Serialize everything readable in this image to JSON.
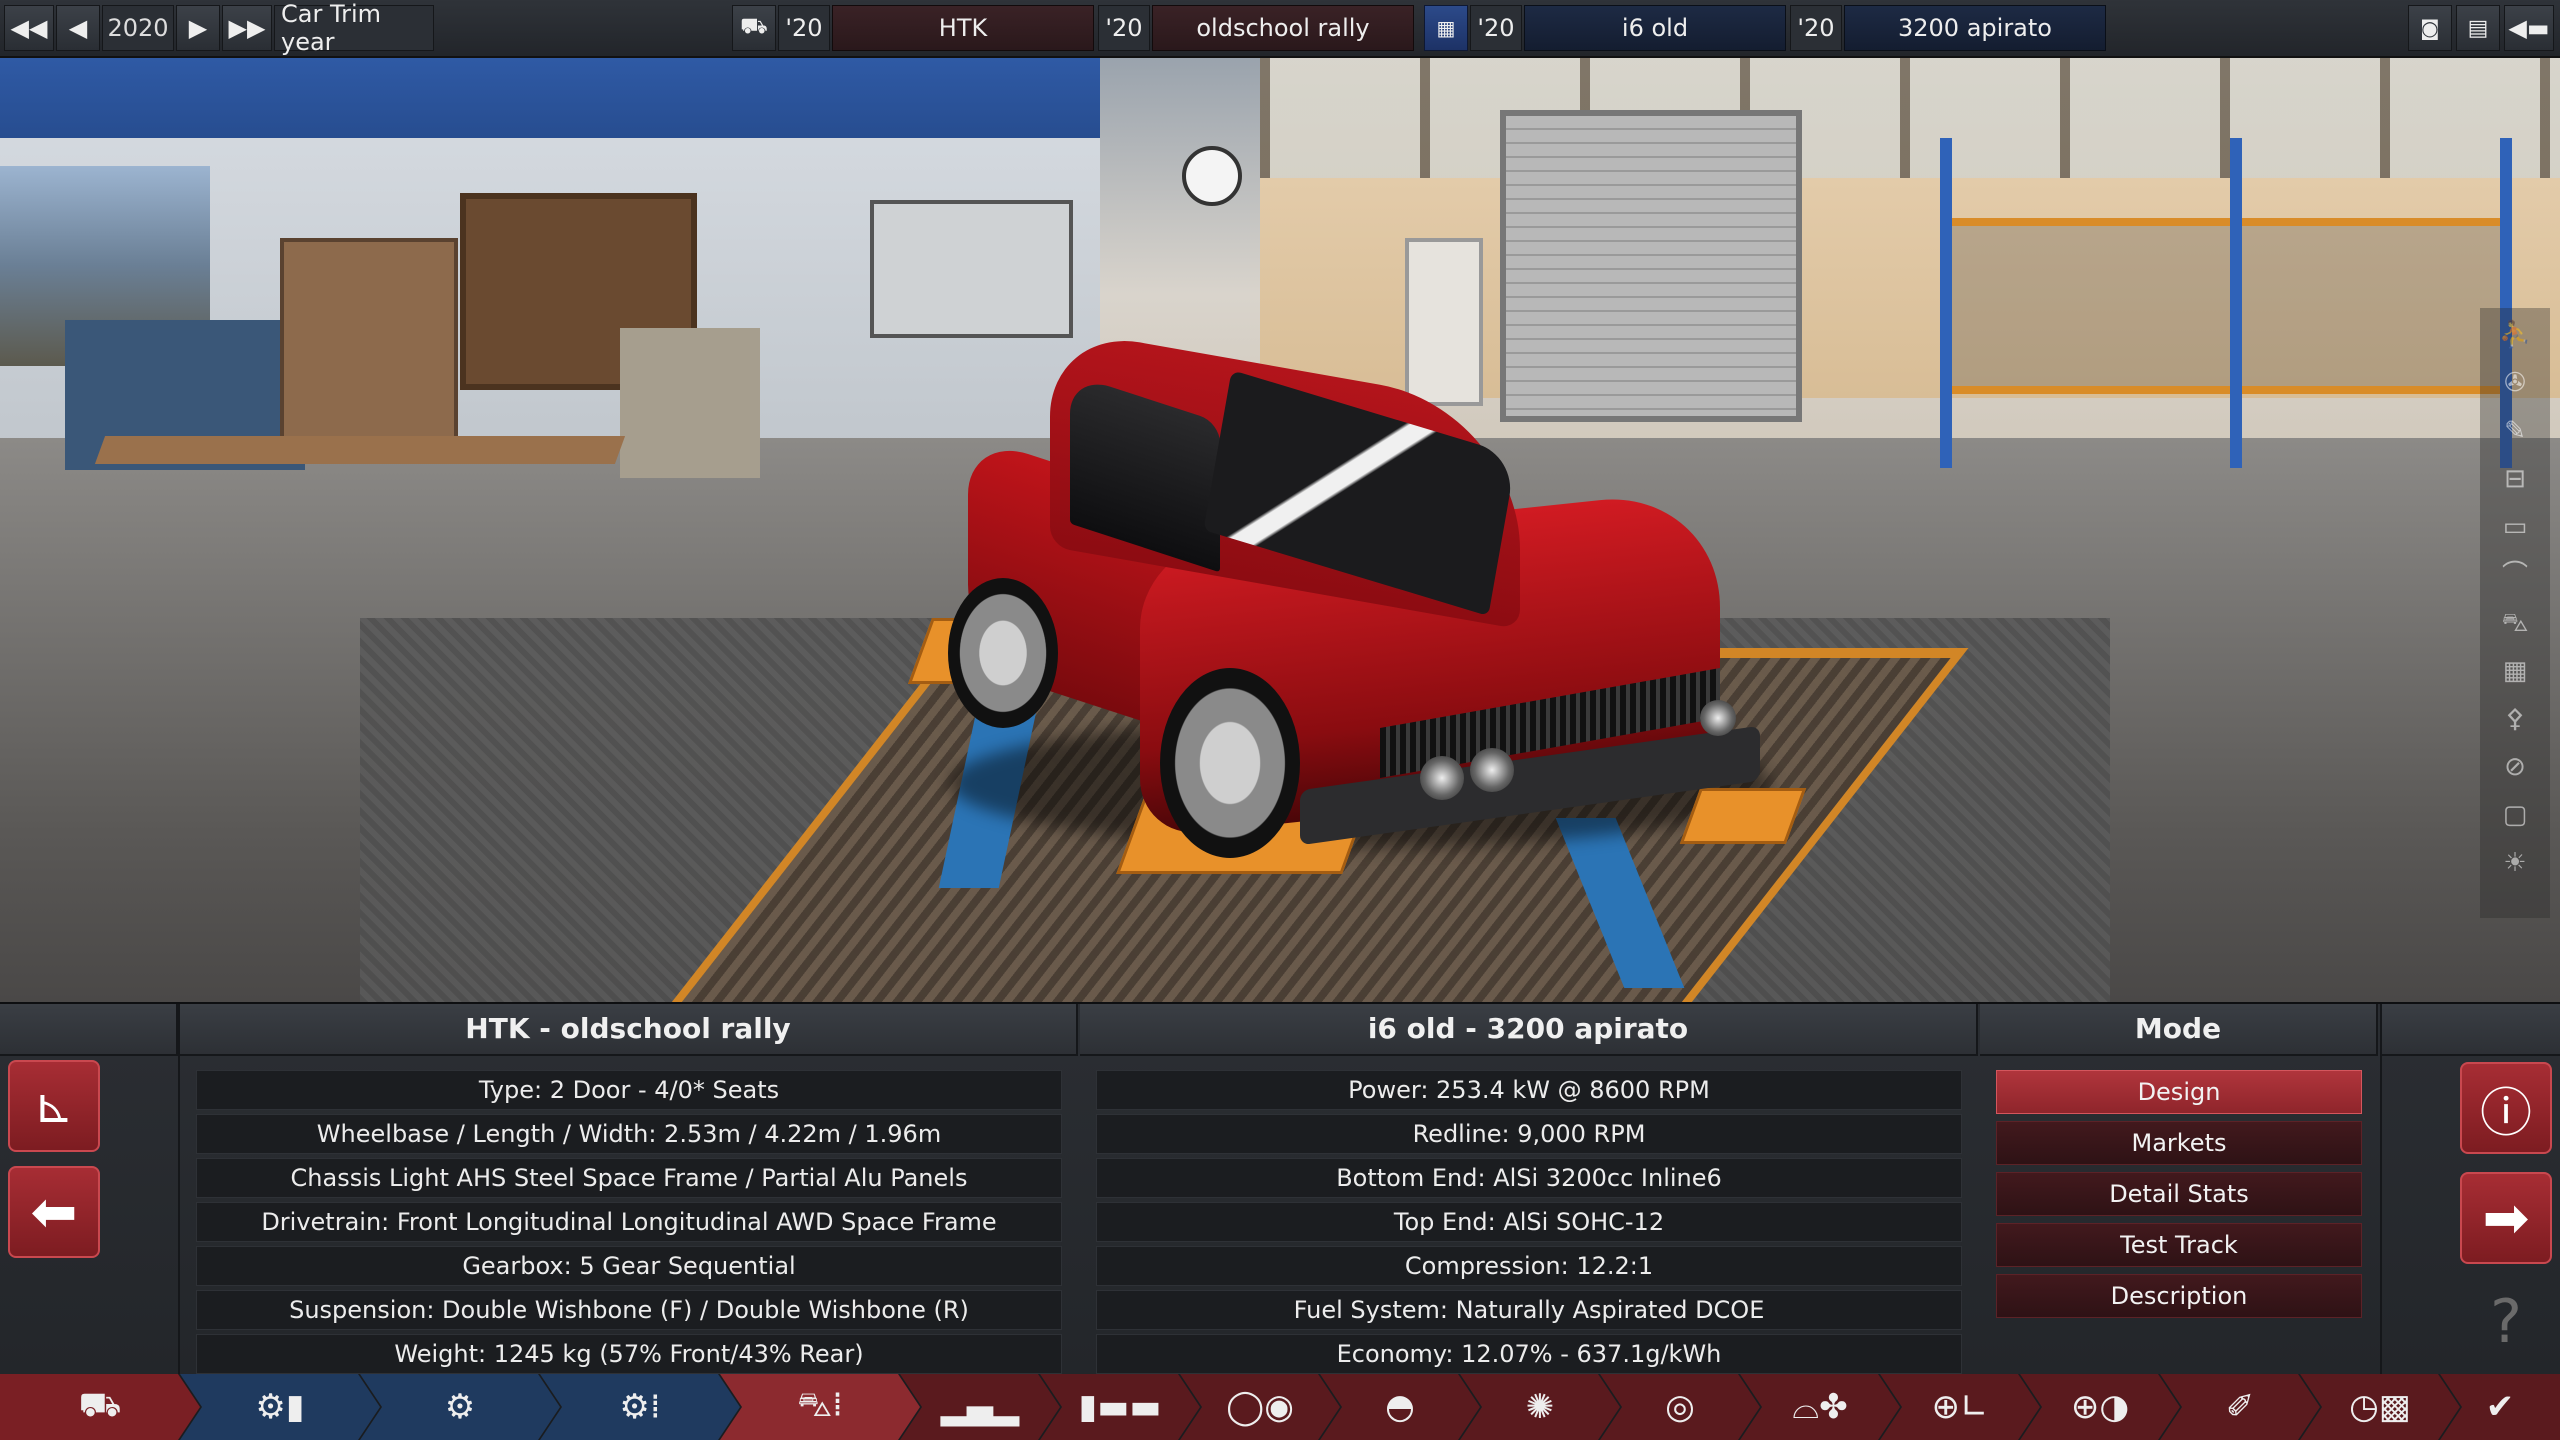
{
  "topbar": {
    "year": "2020",
    "year_label": "Car Trim year",
    "model_year": "'20",
    "model_name": "HTK",
    "trim_year": "'20",
    "trim_name": "oldschool rally",
    "engine_year": "'20",
    "engine_name": "i6  old",
    "variant_year": "'20",
    "variant_name": "3200 apirato"
  },
  "car_panel": {
    "title": "HTK - oldschool rally",
    "rows": [
      "Type: 2 Door - 4/0* Seats",
      "Wheelbase / Length / Width: 2.53m / 4.22m / 1.96m",
      "Chassis Light AHS Steel Space Frame / Partial Alu Panels",
      "Drivetrain: Front Longitudinal Longitudinal AWD Space Frame",
      "Gearbox: 5 Gear Sequential",
      "Suspension: Double Wishbone (F) / Double Wishbone (R)",
      "Weight: 1245 kg (57% Front/43% Rear)"
    ]
  },
  "engine_panel": {
    "title": "i6  old - 3200 apirato",
    "rows": [
      "Power: 253.4 kW @ 8600 RPM",
      "Redline:  9,000 RPM",
      "Bottom End: AlSi 3200cc Inline6",
      "Top End: AlSi SOHC-12",
      "Compression: 12.2:1",
      "Fuel System: Naturally Aspirated DCOE",
      "Economy: 12.07% - 637.1g/kWh"
    ]
  },
  "mode_panel": {
    "title": "Mode",
    "buttons": [
      "Design",
      "Markets",
      "Detail Stats",
      "Test Track",
      "Description"
    ],
    "active": "Design"
  },
  "icons": {
    "top_first": "⏮",
    "top_prev": "◀",
    "top_next": "▶",
    "top_last": "⏭",
    "car": "🚘",
    "engine": "▦",
    "camera": "📷",
    "calc": "▦",
    "back": "⬅",
    "axis": "∟",
    "left_arrow": "🡄",
    "right_arrow": "🡆",
    "warning": "!",
    "help": "?"
  },
  "colors": {
    "accent_red": "#b0353c",
    "nav_blue": "#1f3a5f",
    "nav_red": "#7a1f24"
  }
}
